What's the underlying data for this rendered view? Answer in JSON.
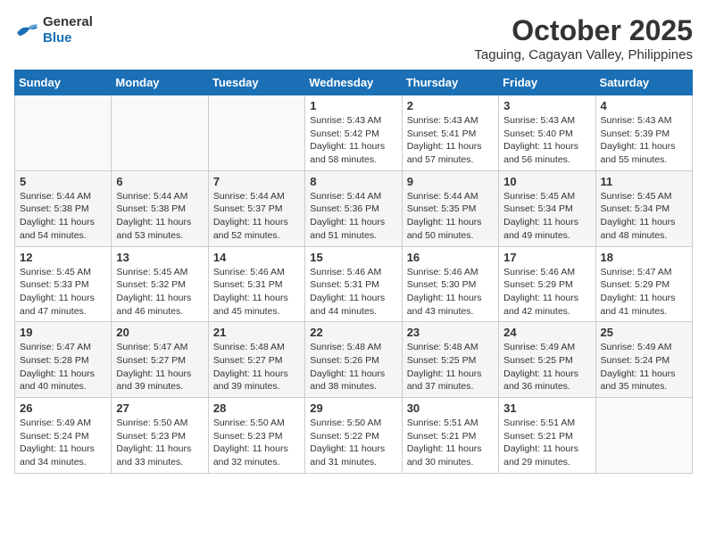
{
  "header": {
    "logo_general": "General",
    "logo_blue": "Blue",
    "title": "October 2025",
    "subtitle": "Taguing, Cagayan Valley, Philippines"
  },
  "calendar": {
    "weekdays": [
      "Sunday",
      "Monday",
      "Tuesday",
      "Wednesday",
      "Thursday",
      "Friday",
      "Saturday"
    ],
    "weeks": [
      [
        {
          "day": "",
          "info": ""
        },
        {
          "day": "",
          "info": ""
        },
        {
          "day": "",
          "info": ""
        },
        {
          "day": "1",
          "info": "Sunrise: 5:43 AM\nSunset: 5:42 PM\nDaylight: 11 hours and 58 minutes."
        },
        {
          "day": "2",
          "info": "Sunrise: 5:43 AM\nSunset: 5:41 PM\nDaylight: 11 hours and 57 minutes."
        },
        {
          "day": "3",
          "info": "Sunrise: 5:43 AM\nSunset: 5:40 PM\nDaylight: 11 hours and 56 minutes."
        },
        {
          "day": "4",
          "info": "Sunrise: 5:43 AM\nSunset: 5:39 PM\nDaylight: 11 hours and 55 minutes."
        }
      ],
      [
        {
          "day": "5",
          "info": "Sunrise: 5:44 AM\nSunset: 5:38 PM\nDaylight: 11 hours and 54 minutes."
        },
        {
          "day": "6",
          "info": "Sunrise: 5:44 AM\nSunset: 5:38 PM\nDaylight: 11 hours and 53 minutes."
        },
        {
          "day": "7",
          "info": "Sunrise: 5:44 AM\nSunset: 5:37 PM\nDaylight: 11 hours and 52 minutes."
        },
        {
          "day": "8",
          "info": "Sunrise: 5:44 AM\nSunset: 5:36 PM\nDaylight: 11 hours and 51 minutes."
        },
        {
          "day": "9",
          "info": "Sunrise: 5:44 AM\nSunset: 5:35 PM\nDaylight: 11 hours and 50 minutes."
        },
        {
          "day": "10",
          "info": "Sunrise: 5:45 AM\nSunset: 5:34 PM\nDaylight: 11 hours and 49 minutes."
        },
        {
          "day": "11",
          "info": "Sunrise: 5:45 AM\nSunset: 5:34 PM\nDaylight: 11 hours and 48 minutes."
        }
      ],
      [
        {
          "day": "12",
          "info": "Sunrise: 5:45 AM\nSunset: 5:33 PM\nDaylight: 11 hours and 47 minutes."
        },
        {
          "day": "13",
          "info": "Sunrise: 5:45 AM\nSunset: 5:32 PM\nDaylight: 11 hours and 46 minutes."
        },
        {
          "day": "14",
          "info": "Sunrise: 5:46 AM\nSunset: 5:31 PM\nDaylight: 11 hours and 45 minutes."
        },
        {
          "day": "15",
          "info": "Sunrise: 5:46 AM\nSunset: 5:31 PM\nDaylight: 11 hours and 44 minutes."
        },
        {
          "day": "16",
          "info": "Sunrise: 5:46 AM\nSunset: 5:30 PM\nDaylight: 11 hours and 43 minutes."
        },
        {
          "day": "17",
          "info": "Sunrise: 5:46 AM\nSunset: 5:29 PM\nDaylight: 11 hours and 42 minutes."
        },
        {
          "day": "18",
          "info": "Sunrise: 5:47 AM\nSunset: 5:29 PM\nDaylight: 11 hours and 41 minutes."
        }
      ],
      [
        {
          "day": "19",
          "info": "Sunrise: 5:47 AM\nSunset: 5:28 PM\nDaylight: 11 hours and 40 minutes."
        },
        {
          "day": "20",
          "info": "Sunrise: 5:47 AM\nSunset: 5:27 PM\nDaylight: 11 hours and 39 minutes."
        },
        {
          "day": "21",
          "info": "Sunrise: 5:48 AM\nSunset: 5:27 PM\nDaylight: 11 hours and 39 minutes."
        },
        {
          "day": "22",
          "info": "Sunrise: 5:48 AM\nSunset: 5:26 PM\nDaylight: 11 hours and 38 minutes."
        },
        {
          "day": "23",
          "info": "Sunrise: 5:48 AM\nSunset: 5:25 PM\nDaylight: 11 hours and 37 minutes."
        },
        {
          "day": "24",
          "info": "Sunrise: 5:49 AM\nSunset: 5:25 PM\nDaylight: 11 hours and 36 minutes."
        },
        {
          "day": "25",
          "info": "Sunrise: 5:49 AM\nSunset: 5:24 PM\nDaylight: 11 hours and 35 minutes."
        }
      ],
      [
        {
          "day": "26",
          "info": "Sunrise: 5:49 AM\nSunset: 5:24 PM\nDaylight: 11 hours and 34 minutes."
        },
        {
          "day": "27",
          "info": "Sunrise: 5:50 AM\nSunset: 5:23 PM\nDaylight: 11 hours and 33 minutes."
        },
        {
          "day": "28",
          "info": "Sunrise: 5:50 AM\nSunset: 5:23 PM\nDaylight: 11 hours and 32 minutes."
        },
        {
          "day": "29",
          "info": "Sunrise: 5:50 AM\nSunset: 5:22 PM\nDaylight: 11 hours and 31 minutes."
        },
        {
          "day": "30",
          "info": "Sunrise: 5:51 AM\nSunset: 5:21 PM\nDaylight: 11 hours and 30 minutes."
        },
        {
          "day": "31",
          "info": "Sunrise: 5:51 AM\nSunset: 5:21 PM\nDaylight: 11 hours and 29 minutes."
        },
        {
          "day": "",
          "info": ""
        }
      ]
    ]
  }
}
